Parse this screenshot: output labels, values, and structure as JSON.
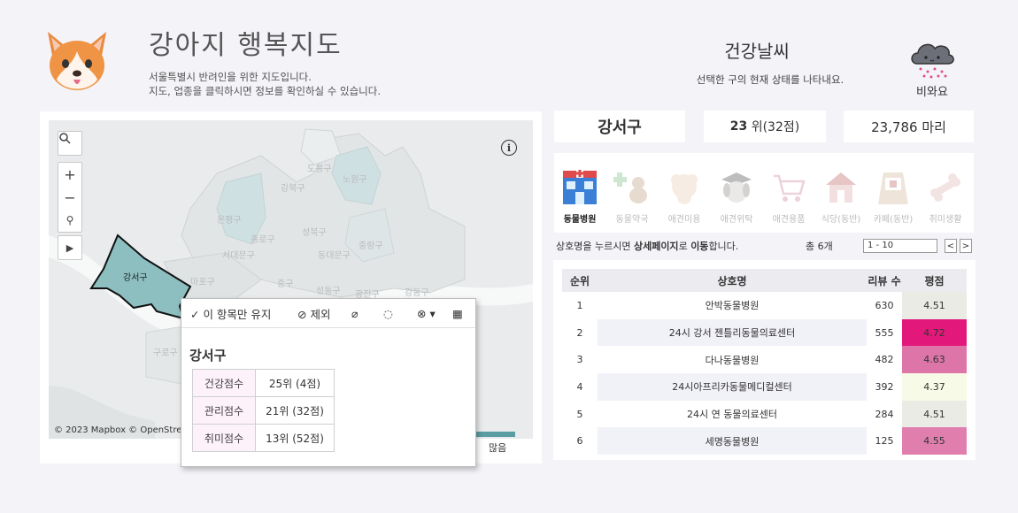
{
  "header": {
    "title": "강아지 행복지도",
    "subtitle_line1": "서울특별시 반려인을 위한 지도입니다.",
    "subtitle_line2": "지도, 업종을 클릭하시면 정보를 확인하실 수 있습니다."
  },
  "weather": {
    "title": "건강날씨",
    "subtitle": "선택한 구의 현재 상태를 나타내요.",
    "icon": "rain-cloud-icon",
    "label": "비와요"
  },
  "map": {
    "selected_region": "강서구",
    "district_labels": [
      "도봉구",
      "노원구",
      "강북구",
      "은평구",
      "성북구",
      "종로구",
      "중랑구",
      "서대문구",
      "동대문구",
      "마포구",
      "중구",
      "성동구",
      "광진구",
      "강동구",
      "구로구",
      "용산구"
    ],
    "attribution": "© 2023 Mapbox © OpenStreetMap",
    "legend_high": "많음",
    "controls": [
      "search-icon",
      "zoom-in-icon",
      "zoom-out-icon",
      "pin-icon",
      "play-icon"
    ]
  },
  "tooltip": {
    "keep_only": "이 항목만 유지",
    "exclude": "제외",
    "region": "강서구",
    "rows": [
      {
        "key": "건강점수",
        "value": "25위 (4점)"
      },
      {
        "key": "관리점수",
        "value": "21위 (32점)"
      },
      {
        "key": "취미점수",
        "value": "13위 (52점)"
      }
    ]
  },
  "stats": {
    "region": "강서구",
    "rank_num": "23",
    "rank_suffix": "위(32점)",
    "count": "23,786 마리"
  },
  "categories": [
    {
      "label": "동물병원",
      "icon": "hospital-icon",
      "active": true
    },
    {
      "label": "동물약국",
      "icon": "pharmacy-icon",
      "active": false
    },
    {
      "label": "애견미용",
      "icon": "grooming-icon",
      "active": false
    },
    {
      "label": "애견위탁",
      "icon": "boarding-icon",
      "active": false
    },
    {
      "label": "애견용품",
      "icon": "cart-icon",
      "active": false
    },
    {
      "label": "식당(동반)",
      "icon": "restaurant-icon",
      "active": false
    },
    {
      "label": "카페(동반)",
      "icon": "cafe-icon",
      "active": false
    },
    {
      "label": "취미생활",
      "icon": "bone-icon",
      "active": false
    }
  ],
  "list": {
    "instruction_prefix": "상호명을 누르시면 ",
    "instruction_bold": "상세페이지",
    "instruction_mid": "로 ",
    "instruction_bold2": "이동",
    "instruction_suffix": "합니다.",
    "total": "총 6개",
    "pager": "1 - 10",
    "columns": [
      "순위",
      "상호명",
      "리뷰 수",
      "평점"
    ],
    "rows": [
      {
        "rank": "1",
        "name": "안박동물병원",
        "reviews": "630",
        "rating": "4.51",
        "color": "#e9ebe4"
      },
      {
        "rank": "2",
        "name": "24시 강서 젠틀리동물의료센터",
        "reviews": "555",
        "rating": "4.72",
        "color": "#e2197a"
      },
      {
        "rank": "3",
        "name": "다나동물병원",
        "reviews": "482",
        "rating": "4.63",
        "color": "#de75a8"
      },
      {
        "rank": "4",
        "name": "24시아프리카동물메디컬센터",
        "reviews": "392",
        "rating": "4.37",
        "color": "#f7fae6"
      },
      {
        "rank": "5",
        "name": "24시 연 동물의료센터",
        "reviews": "284",
        "rating": "4.51",
        "color": "#e9ebe4"
      },
      {
        "rank": "6",
        "name": "세명동물병원",
        "reviews": "125",
        "rating": "4.55",
        "color": "#e07fae"
      }
    ]
  }
}
